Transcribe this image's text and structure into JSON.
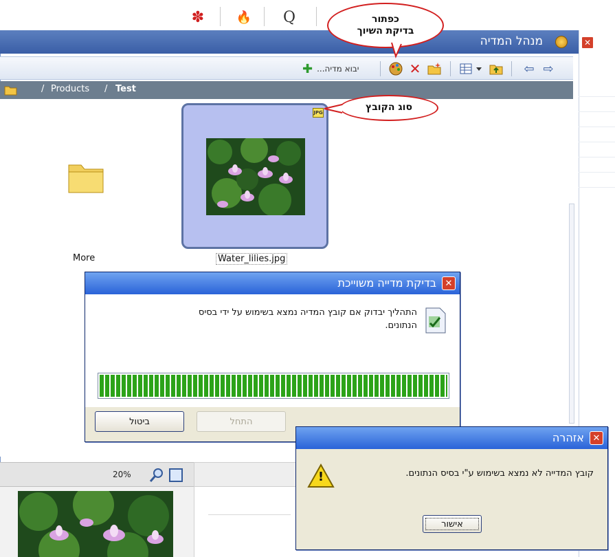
{
  "top_icons": [
    "flower-icon",
    "fire-icon",
    "search-q-icon"
  ],
  "top_icon_glyphs": {
    "flower": "✽",
    "fire": "🔥",
    "q": "Q"
  },
  "window": {
    "title": "מנהל המדיה",
    "close": "✕"
  },
  "toolbar": {
    "add_media_label": "יבוא מדיה...",
    "add_glyph": "✚"
  },
  "breadcrumb": {
    "sep1": "/",
    "item1": "Products",
    "sep2": "/",
    "item2": "Test"
  },
  "files": [
    {
      "name": "More",
      "type": "folder"
    },
    {
      "name": "Water_lilies.jpg",
      "type": "image",
      "badge": "JPG"
    }
  ],
  "callouts": {
    "check_button": "כפתור\nבדיקת השיוך",
    "file_type": "סוג הקובץ"
  },
  "check_dialog": {
    "title": "בדיקת מדייה משוייכת",
    "message": "התהליך יבדוק אם קובץ המדיה נמצא בשימוש על ידי בסיס הנתונים.",
    "progress_percent": 100,
    "start_label": "התחל",
    "cancel_label": "ביטול"
  },
  "warning_dialog": {
    "title": "אזהרה",
    "message": "קובץ המדייה לא נמצא בשימוש ע\"י בסיס הנתונים.",
    "ok_label": "אישור",
    "icon_glyph": "!"
  },
  "preview": {
    "zoom": "20%"
  },
  "colors": {
    "accent_red": "#d21f1f",
    "progress_green": "#2ca319",
    "title_blue": "#3a5ea6"
  }
}
